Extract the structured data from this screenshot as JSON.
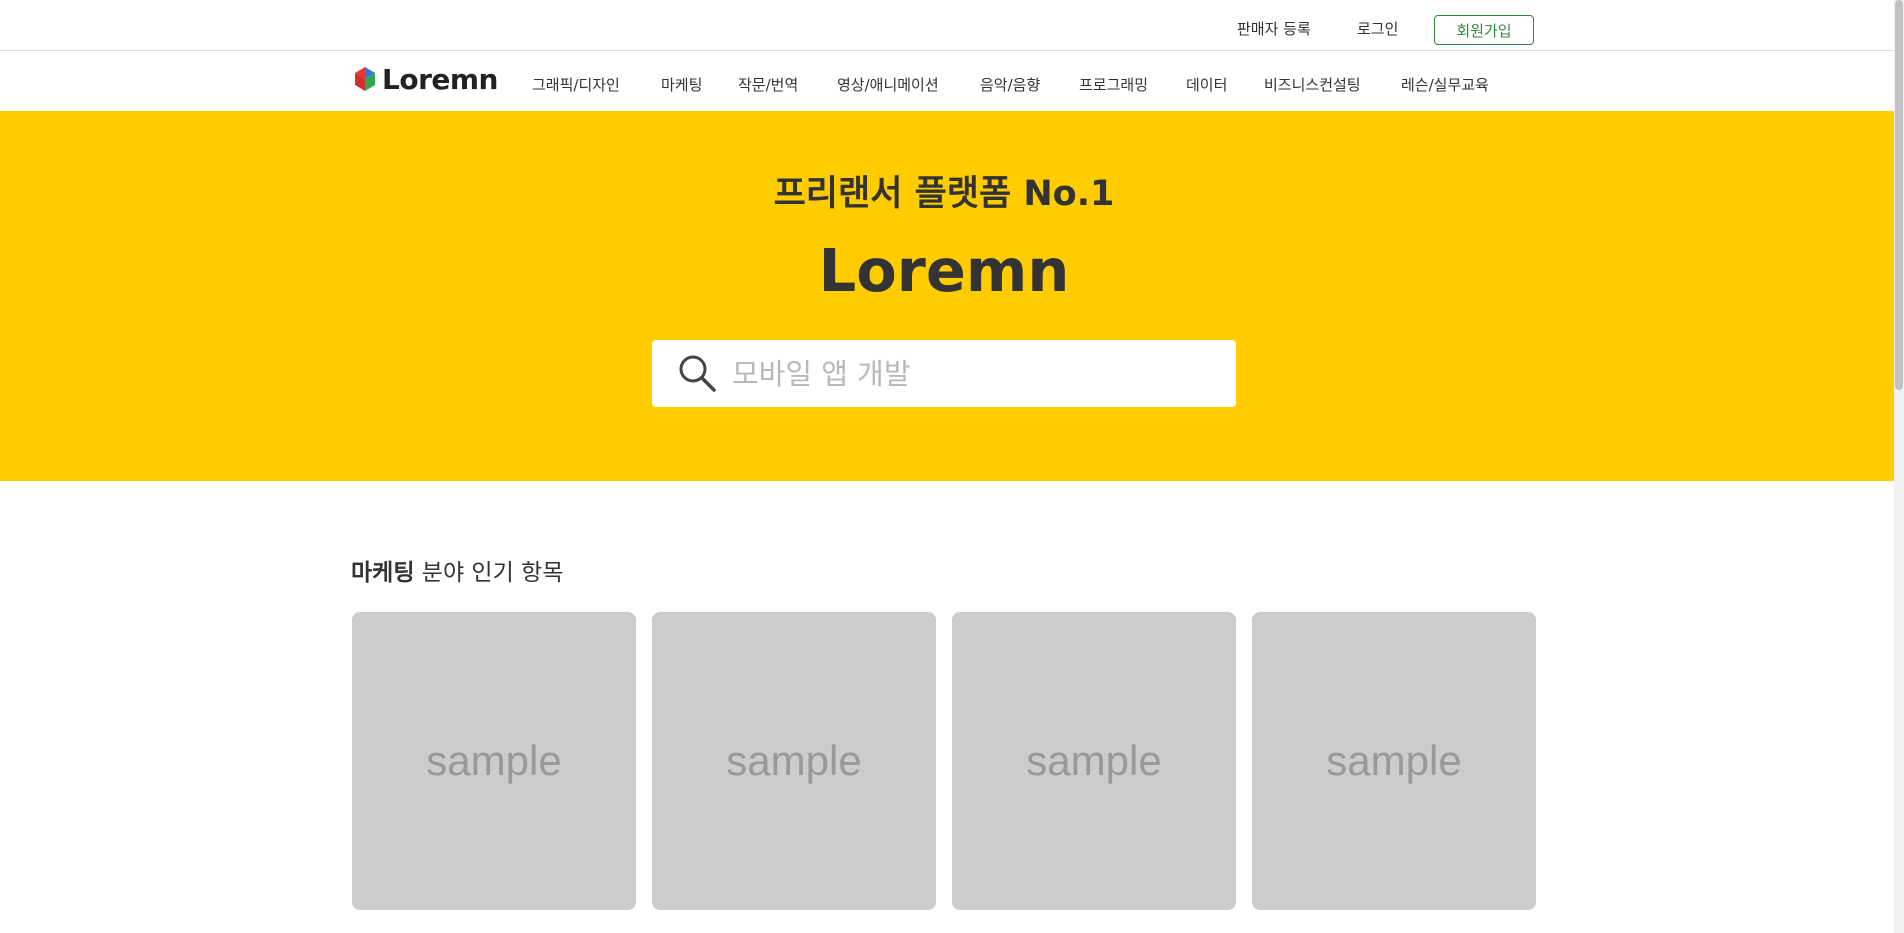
{
  "topbar": {
    "seller_register": "판매자 등록",
    "login": "로그인",
    "signup": "회원가입"
  },
  "brand": {
    "name": "Loremn"
  },
  "nav": {
    "categories": [
      "그래픽/디자인",
      "마케팅",
      "작문/번역",
      "영상/애니메이션",
      "음악/음향",
      "프로그래밍",
      "데이터",
      "비즈니스컨설팅",
      "레슨/실무교육"
    ]
  },
  "hero": {
    "subtitle": "프리랜서 플랫폼 No.1",
    "title": "Loremn",
    "search_placeholder": "모바일 앱 개발"
  },
  "section": {
    "title_strong": "마케팅",
    "title_rest": " 분야 인기 항목",
    "cards": [
      "sample",
      "sample",
      "sample",
      "sample"
    ]
  },
  "colors": {
    "hero_bg": "#ffcc00",
    "signup_accent": "#2e8b3a",
    "card_bg": "#cccccc"
  },
  "icons": {
    "logo": "hexagon-logo-icon",
    "search": "search-icon"
  }
}
